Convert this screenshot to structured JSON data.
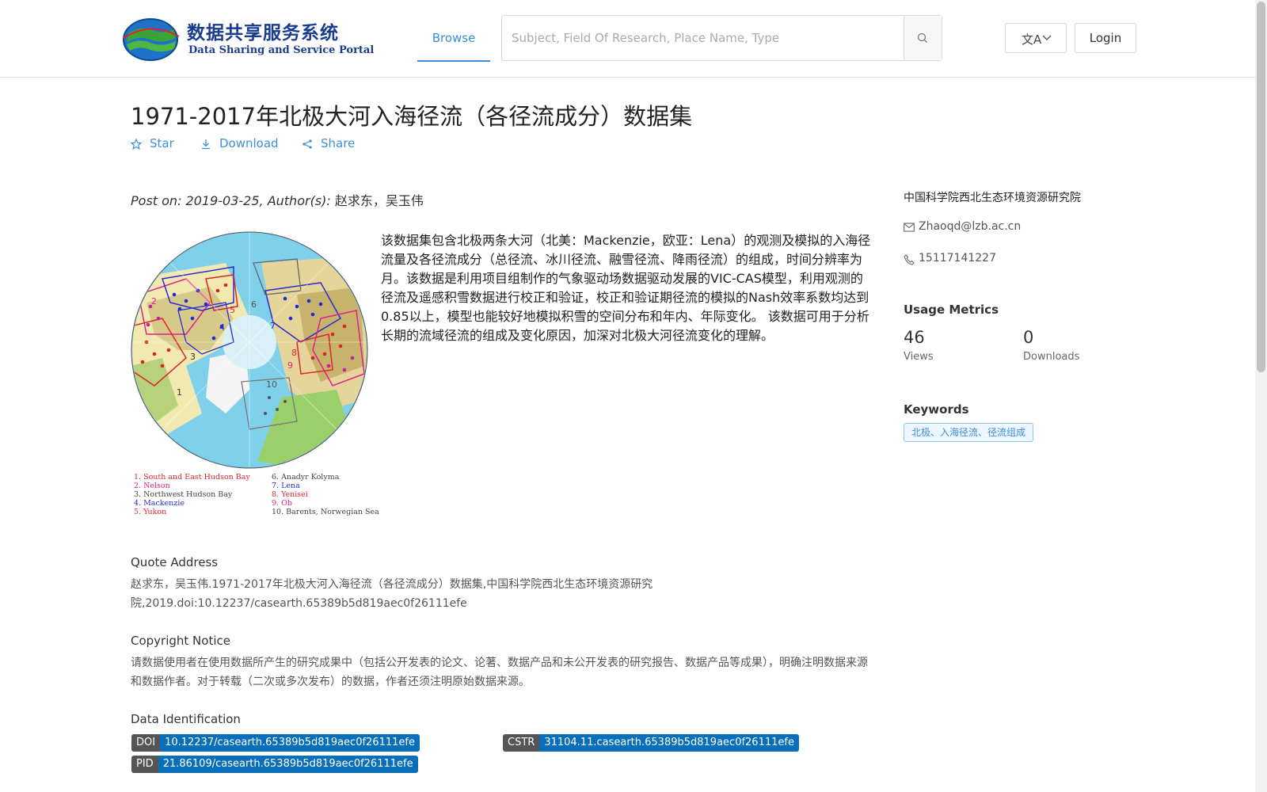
{
  "header": {
    "logo_cn": "数据共享服务系统",
    "logo_en": "Data Sharing and Service Portal",
    "nav_browse": "Browse",
    "search_placeholder": "Subject, Field Of Research, Place Name, Type",
    "search_value": "",
    "language_icon": "translate-icon",
    "login_label": "Login"
  },
  "dataset": {
    "title": "1971-2017年北极大河入海径流（各径流成分）数据集",
    "actions": {
      "star": "Star",
      "download": "Download",
      "share": "Share"
    },
    "post_label": "Post on: 2019-03-25, Author(s): ",
    "authors": "赵求东，吴玉伟",
    "description": "该数据集包含北极两条大河（北美：Mackenzie，欧亚：Lena）的观测及模拟的入海径流量及各径流成分（总径流、冰川径流、融雪径流、降雨径流）的组成，时间分辨率为月。该数据是利用项目组制作的气象驱动场数据驱动发展的VIC-CAS模型，利用观测的径流及遥感积雪数据进行校正和验证，校正和验证期径流的模拟的Nash效率系数均达到0.85以上，模型也能较好地模拟积雪的空间分布和年内、年际变化。 该数据可用于分析长期的流域径流的组成及变化原因，加深对北极大河径流变化的理解。",
    "figure": {
      "basin_labels": [
        "1",
        "2",
        "3",
        "4",
        "5",
        "6",
        "7",
        "8",
        "9",
        "10"
      ],
      "legend_left": [
        "1. South and East Hudson Bay",
        "2. Nelson",
        "3. Northwest Hudson Bay",
        "4. Mackenzie",
        "5. Yukon"
      ],
      "legend_right": [
        "6. Anadyr Kolyma",
        "7. Lena",
        "8. Yenisei",
        "9. Ob",
        "10. Barents, Norwegian Sea"
      ]
    }
  },
  "sections": {
    "quote_title": "Quote Address",
    "quote_text": "赵求东，吴玉伟.1971-2017年北极大河入海径流（各径流成分）数据集,中国科学院西北生态环境资源研究院,2019.doi:10.12237/casearth.65389b5d819aec0f26111efe",
    "copyright_title": "Copyright Notice",
    "copyright_text": "请数据使用者在使用数据所产生的研究成果中（包括公开发表的论文、论著、数据产品和未公开发表的研究报告、数据产品等成果），明确注明数据来源和数据作者。对于转载（二次或多次发布）的数据，作者还须注明原始数据来源。",
    "ident_title": "Data Identification",
    "doi_key": "DOI",
    "doi_val": "10.12237/casearth.65389b5d819aec0f26111efe",
    "cstr_key": "CSTR",
    "cstr_val": "31104.11.casearth.65389b5d819aec0f26111efe",
    "pid_key": "PID",
    "pid_val": "21.86109/casearth.65389b5d819aec0f26111efe"
  },
  "sidebar": {
    "org": "中国科学院西北生态环境资源研究院",
    "email": "Zhaoqd@lzb.ac.cn",
    "phone": "15117141227",
    "usage_title": "Usage Metrics",
    "views_num": "46",
    "views_label": "Views",
    "downloads_num": "0",
    "downloads_label": "Downloads",
    "keywords_title": "Keywords",
    "keyword": "北极、入海径流、径流组成"
  },
  "colors": {
    "accent": "#3b8ede",
    "badge_key": "#555555",
    "badge_value": "#0a6fb8"
  }
}
